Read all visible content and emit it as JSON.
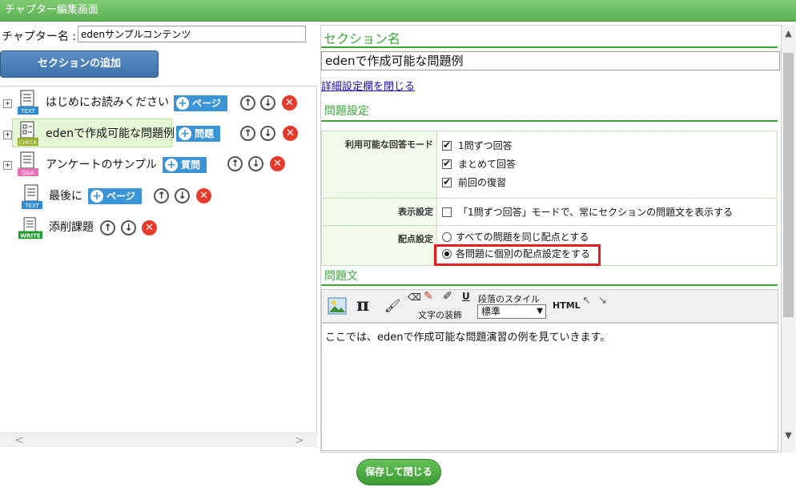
{
  "window": {
    "title": "チャプター編集画面"
  },
  "chapter": {
    "label": "チャプター名 :",
    "value": "edenサンプルコンテンツ"
  },
  "add_section_label": "セクションの追加",
  "tree": {
    "nodes": [
      {
        "label": "はじめにお読みください",
        "icon": "TEXT",
        "chip": "ページ"
      },
      {
        "label": "edenで作成可能な問題例",
        "icon": "CHECK",
        "chip": "問題"
      },
      {
        "label": "アンケートのサンプル",
        "icon": "Q&A",
        "chip": "質問"
      },
      {
        "label": "最後に",
        "icon": "TEXT",
        "chip": "ページ"
      },
      {
        "label": "添削課題",
        "icon": "WRITE"
      }
    ]
  },
  "section": {
    "heading": "セクション名",
    "name": "edenで作成可能な問題例",
    "collapse_link": "詳細設定欄を閉じる",
    "settings_heading": "問題設定",
    "rows": {
      "answer_mode": {
        "label": "利用可能な回答モード",
        "options": [
          "1問ずつ回答",
          "まとめて回答",
          "前回の復習"
        ]
      },
      "display": {
        "label": "表示設定",
        "option": "「1問ずつ回答」モードで、常にセクションの問題文を表示する"
      },
      "scoring": {
        "label": "配点設定",
        "options": [
          "すべての問題を同じ配点とする",
          "各問題に個別の配点設定をする"
        ]
      }
    },
    "body_heading": "問題文",
    "toolbar": {
      "decoration_label": "文字の装飾",
      "paragraph_label": "段落のスタイル",
      "paragraph_value": "標準",
      "html_label": "HTML"
    },
    "body_text": "ここでは、edenで作成可能な問題演習の例を見ていきます。"
  },
  "save_label": "保存して閉じる",
  "colors": {
    "accent_green": "#3aa637",
    "chip_blue": "#3b94d6",
    "highlight_red": "#e02020"
  }
}
